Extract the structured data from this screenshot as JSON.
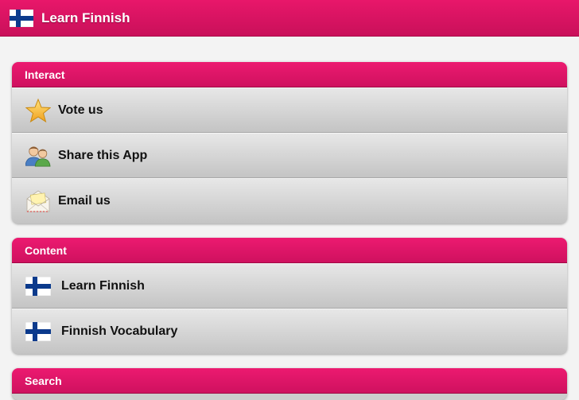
{
  "app": {
    "title": "Learn Finnish"
  },
  "sections": {
    "interact": {
      "header": "Interact",
      "items": [
        {
          "label": "Vote us",
          "icon": "star-icon"
        },
        {
          "label": "Share this App",
          "icon": "users-icon"
        },
        {
          "label": "Email us",
          "icon": "envelope-icon"
        }
      ]
    },
    "content": {
      "header": "Content",
      "items": [
        {
          "label": "Learn Finnish",
          "icon": "finland-flag-icon"
        },
        {
          "label": "Finnish Vocabulary",
          "icon": "finland-flag-icon"
        }
      ]
    },
    "search": {
      "header": "Search"
    }
  },
  "colors": {
    "accent": "#e3166a",
    "row": "#d4d4d4"
  }
}
